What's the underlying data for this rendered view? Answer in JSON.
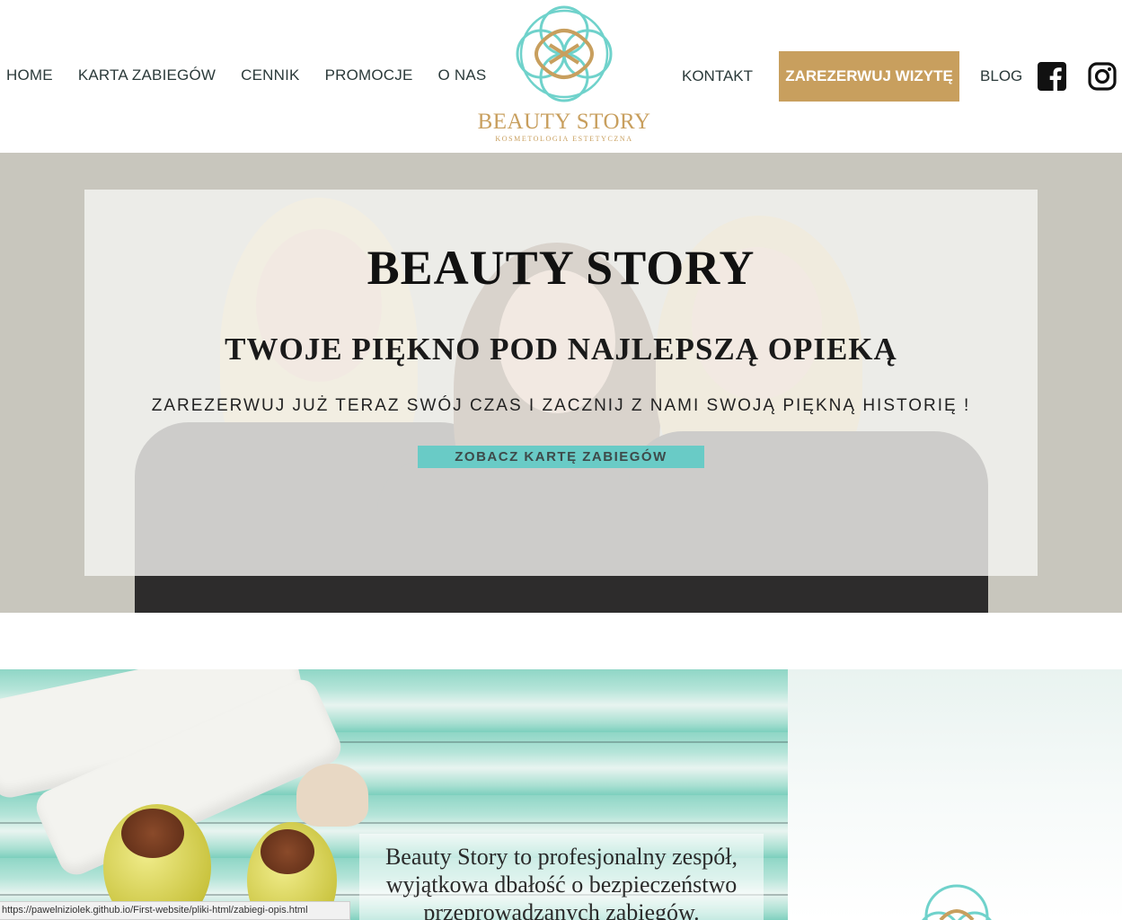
{
  "nav": {
    "left": [
      "HOME",
      "KARTA ZABIEGÓW",
      "CENNIK",
      "PROMOCJE",
      "O NAS"
    ],
    "kontakt": "KONTAKT",
    "reserve": "ZAREZERWUJ WIZYTĘ",
    "blog": "BLOG"
  },
  "logo": {
    "name": "BEAUTY STORY",
    "tagline": "KOSMETOLOGIA ESTETYCZNA"
  },
  "hero": {
    "title": "BEAUTY STORY",
    "subtitle": "TWOJE PIĘKNO POD NAJLEPSZĄ OPIEKĄ",
    "text": "ZAREZERWUJ JUŻ TERAZ SWÓJ CZAS I ZACZNIJ Z NAMI SWOJĄ PIĘKNĄ HISTORIĘ !",
    "button": "ZOBACZ KARTĘ ZABIEGÓW"
  },
  "about": {
    "line1": "Beauty Story to profesjonalny zespół,",
    "line2": "wyjątkowa dbałość o bezpieczeństwo",
    "line3": "przeprowadzanych zabiegów."
  },
  "status_url": "https://pawelniziolek.github.io/First-website/pliki-html/zabiegi-opis.html",
  "colors": {
    "gold": "#c89f5e",
    "teal": "#69cbc6",
    "hero_bg": "#c8c6bd"
  }
}
